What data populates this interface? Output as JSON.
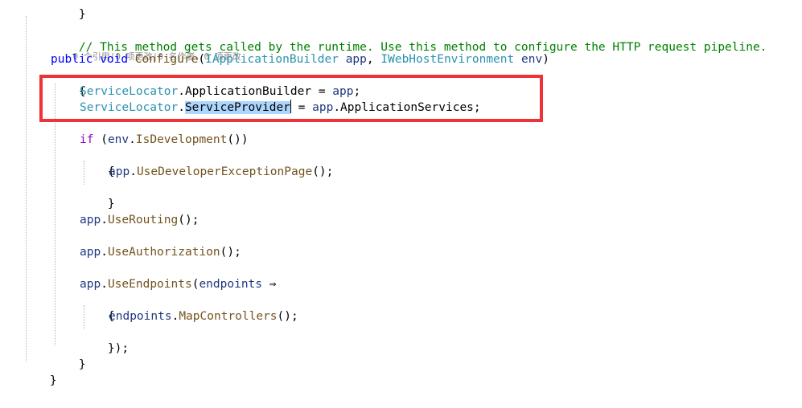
{
  "code": {
    "top_brace": "}",
    "comment": "// This method gets called by the runtime. Use this method to configure the HTTP request pipeline.",
    "codelens": "0 个引用|0 项更改|0 名作者，0 项更改",
    "sig": {
      "public": "public",
      "void": "void",
      "method": "Configure",
      "paren_open": "(",
      "type1": "IApplicationBuilder",
      "param1": "app",
      "comma": ", ",
      "type2": "IWebHostEnvironment",
      "param2": "env",
      "paren_close": ")"
    },
    "open_brace": "{",
    "l1": {
      "type": "ServiceLocator",
      "dot": ".",
      "prop": "ApplicationBuilder",
      "assign": " = ",
      "rhs": "app",
      "end": ";"
    },
    "l2": {
      "type": "ServiceLocator",
      "dot": ".",
      "prop": "ServiceProvider",
      "assign": " = ",
      "rhs": "app",
      "dot2": ".",
      "rhs_prop": "ApplicationServices",
      "end": ";"
    },
    "if_line": {
      "kw": "if",
      "open": " (",
      "obj": "env",
      "dot": ".",
      "method": "IsDevelopment",
      "close": "())"
    },
    "if_open": "{",
    "dev_page": {
      "obj": "app",
      "dot": ".",
      "method": "UseDeveloperExceptionPage",
      "end": "();"
    },
    "if_close": "}",
    "routing": {
      "obj": "app",
      "dot": ".",
      "method": "UseRouting",
      "end": "();"
    },
    "authz": {
      "obj": "app",
      "dot": ".",
      "method": "UseAuthorization",
      "end": "();"
    },
    "endpoints": {
      "obj": "app",
      "dot": ".",
      "method": "UseEndpoints",
      "open": "(",
      "param": "endpoints",
      "arrow": " ⇒"
    },
    "lambda_open": "{",
    "map": {
      "obj": "endpoints",
      "dot": ".",
      "method": "MapControllers",
      "end": "();"
    },
    "lambda_close": "});",
    "method_close": "}",
    "class_close": "}"
  },
  "colors": {
    "highlight_border": "#ee3237",
    "selection": "#add6ff",
    "comment": "#008000",
    "keyword": "#0000ff",
    "control_keyword": "#8f08c4",
    "type": "#2b91af",
    "method": "#74531f",
    "parameter": "#1f377f"
  }
}
